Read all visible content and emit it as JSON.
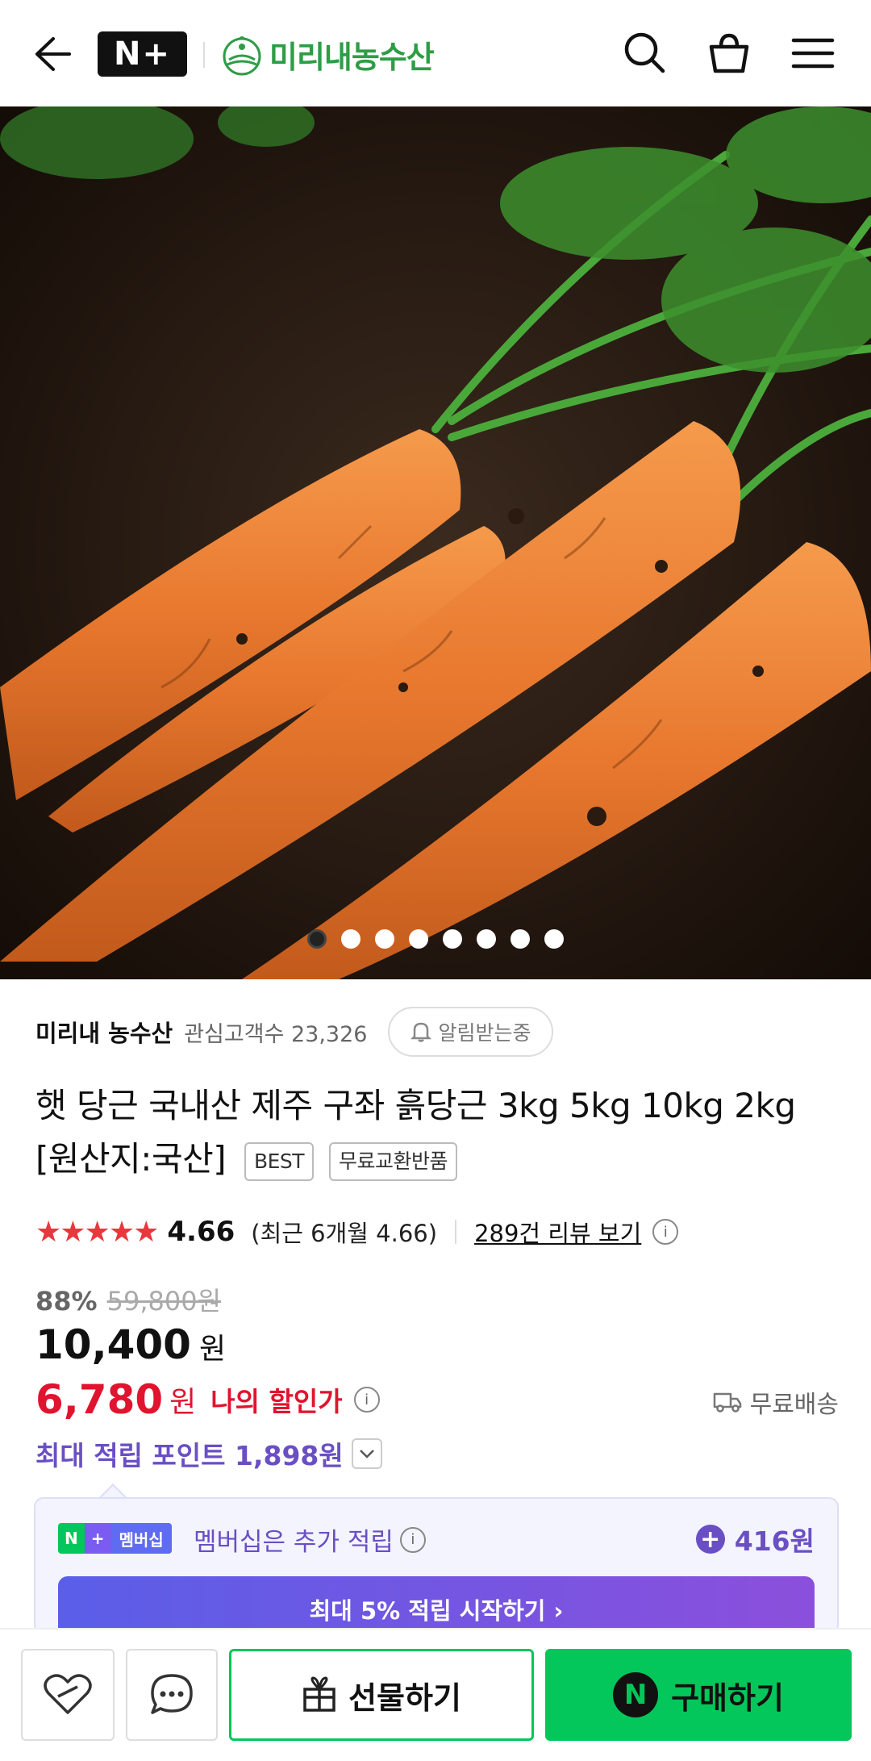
{
  "header": {
    "np_logo": "N+",
    "store_name": "미리내농수산"
  },
  "hero": {
    "page_count": 8,
    "active_index": 0
  },
  "seller": {
    "name": "미리내 농수산",
    "followers": "관심고객수 23,326",
    "alarm_label": "알림받는중"
  },
  "product": {
    "title": "햇 당근 국내산 제주 구좌 흙당근 3kg 5kg 10kg 2kg [원산지:국산]",
    "tags": [
      "BEST",
      "무료교환반품"
    ]
  },
  "rating": {
    "stars": "★★★★★",
    "value": "4.66",
    "recent": "(최근 6개월 4.66)",
    "review_link": "289건 리뷰 보기",
    "info": "i"
  },
  "price": {
    "discount": "88%",
    "original": "59,800원",
    "current": "10,400",
    "won": "원",
    "my_price": "6,780",
    "my_won": "원",
    "my_label": "나의 할인가",
    "shipping": "무료배송"
  },
  "points": {
    "label": "최대 적립 포인트 1,898원"
  },
  "membership": {
    "badge_n": "N",
    "badge_plus": "+",
    "badge_text": "멤버십",
    "text": "멤버십은 추가 적립",
    "points": "416원",
    "cta": "최대 5% 적립 시작하기 ›"
  },
  "bottom_bar": {
    "gift": "선물하기",
    "buy": "구매하기",
    "buy_icon": "N"
  },
  "colors": {
    "naver_green": "#03c75a",
    "discount_red": "#e0142e",
    "points_purple": "#6a4fc4",
    "store_green": "#2e9d46"
  }
}
